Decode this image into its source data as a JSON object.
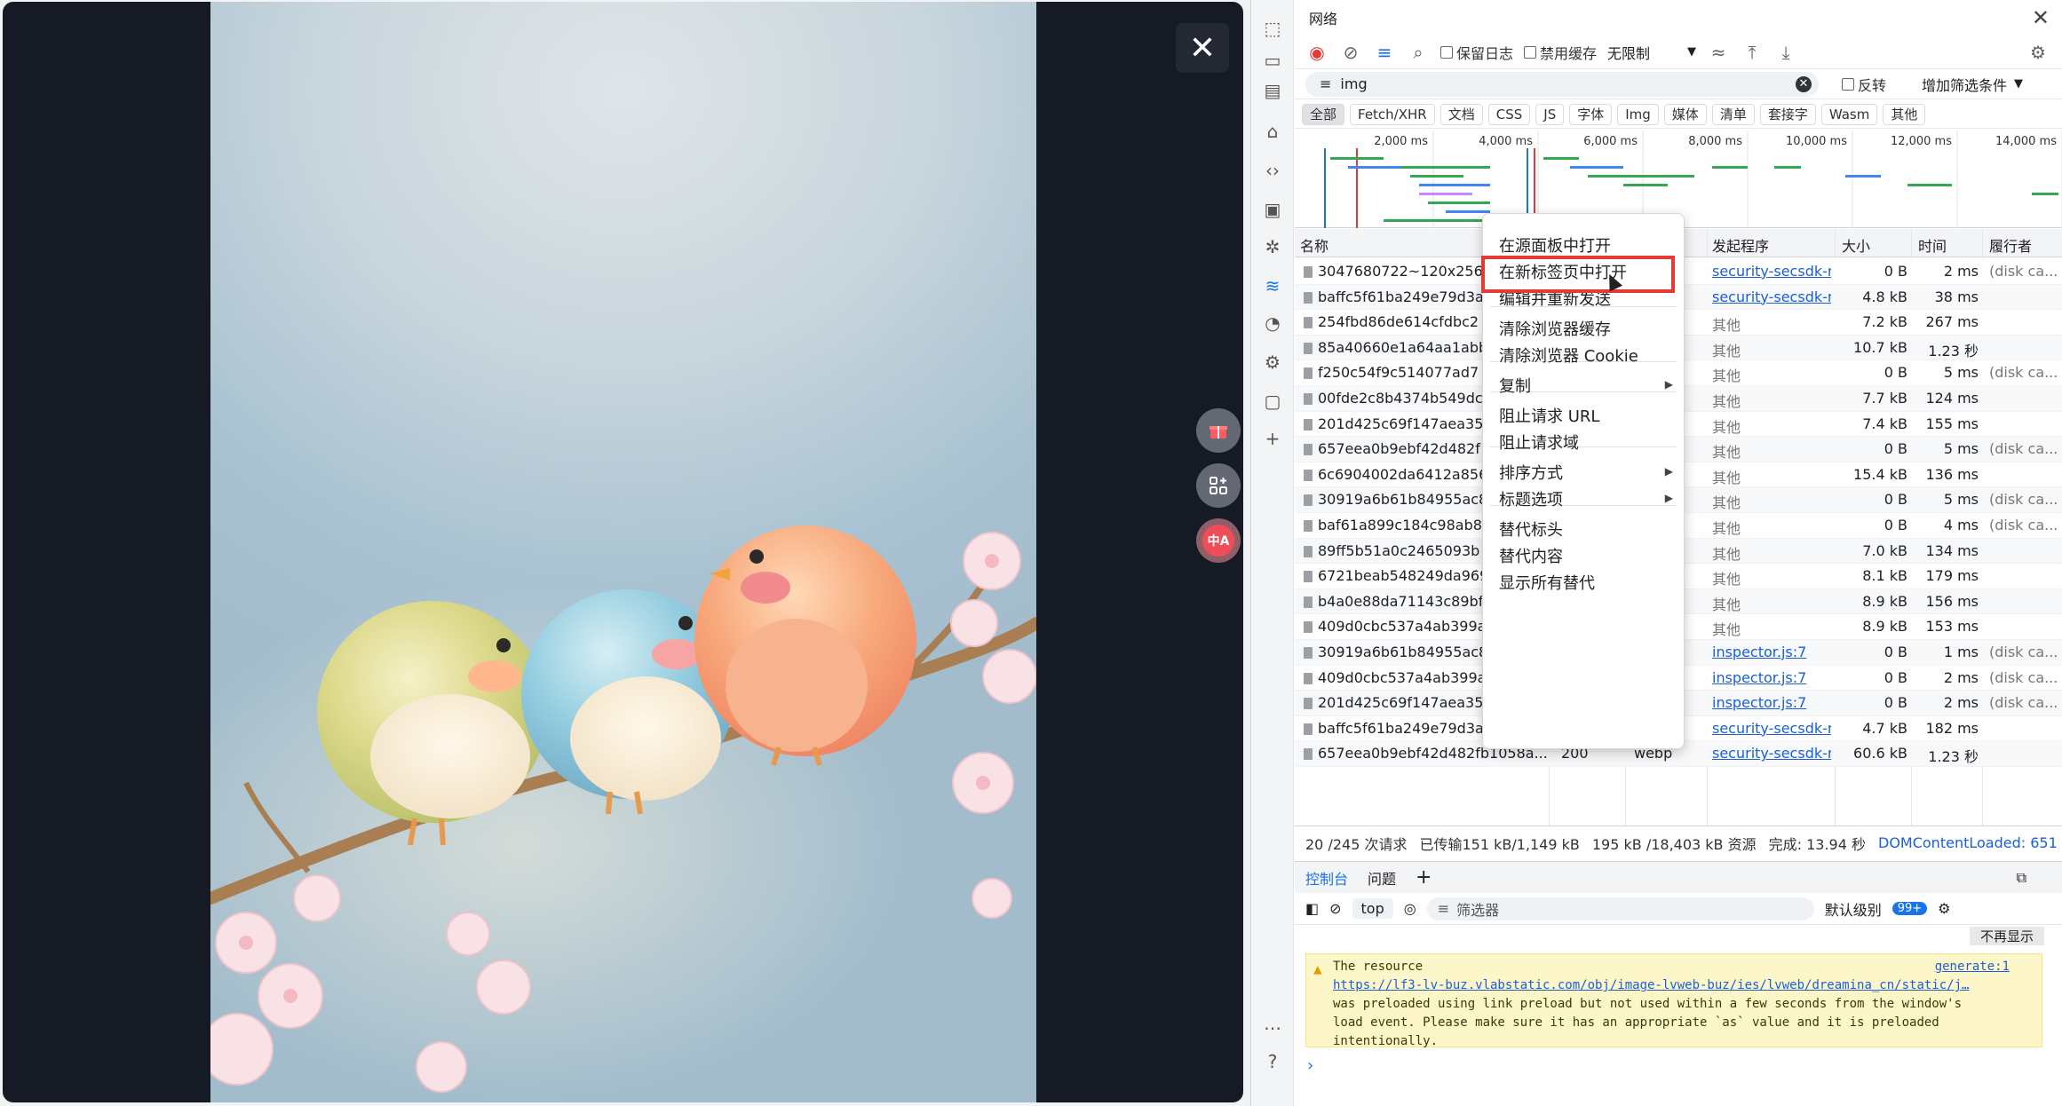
{
  "viewer": {
    "close_icon": "✕",
    "gift_icon": "gift-icon",
    "grid_icon": "grid-icon",
    "translate_label": "中A"
  },
  "devtools": {
    "panel_title": "网络",
    "toolbar": {
      "preserve_log": "保留日志",
      "disable_cache": "禁用缓存",
      "throttle": "无限制"
    },
    "filter": {
      "value": "img",
      "invert": "反转",
      "more_filters": "增加筛选条件"
    },
    "types": [
      "全部",
      "Fetch/XHR",
      "文档",
      "CSS",
      "JS",
      "字体",
      "Img",
      "媒体",
      "清单",
      "套接字",
      "Wasm",
      "其他"
    ],
    "timeline_ticks": [
      "2,000 ms",
      "4,000 ms",
      "6,000 ms",
      "8,000 ms",
      "10,000 ms",
      "12,000 ms",
      "14,000 ms"
    ],
    "columns": {
      "name": "名称",
      "initiator": "发起程序",
      "size": "大小",
      "time": "时间",
      "fulfilled": "履行者"
    },
    "rows": [
      {
        "name": "3047680722~120x256.i",
        "status": "",
        "type": "",
        "initiator": "security-secsdk-ru",
        "size": "0 B",
        "time": "2 ms",
        "fulfilled": "(disk ca..."
      },
      {
        "name": "baffc5f61ba249e79d3a",
        "status": "",
        "type": "",
        "initiator": "security-secsdk-ru",
        "size": "4.8 kB",
        "time": "38 ms",
        "fulfilled": ""
      },
      {
        "name": "254fbd86de614cfdbc2",
        "status": "",
        "type": "",
        "initiator": "其他",
        "size": "7.2 kB",
        "time": "267 ms",
        "fulfilled": ""
      },
      {
        "name": "85a40660e1a64aa1abb",
        "status": "",
        "type": "",
        "initiator": "其他",
        "size": "10.7 kB",
        "time": "1.23 秒",
        "fulfilled": ""
      },
      {
        "name": "f250c54f9c514077ad7",
        "status": "",
        "type": "",
        "initiator": "其他",
        "size": "0 B",
        "time": "5 ms",
        "fulfilled": "(disk ca..."
      },
      {
        "name": "00fde2c8b4374b549dc",
        "status": "",
        "type": "",
        "initiator": "其他",
        "size": "7.7 kB",
        "time": "124 ms",
        "fulfilled": ""
      },
      {
        "name": "201d425c69f147aea35",
        "status": "",
        "type": "",
        "initiator": "其他",
        "size": "7.4 kB",
        "time": "155 ms",
        "fulfilled": ""
      },
      {
        "name": "657eea0b9ebf42d482f",
        "status": "",
        "type": "",
        "initiator": "其他",
        "size": "0 B",
        "time": "5 ms",
        "fulfilled": "(disk ca..."
      },
      {
        "name": "6c6904002da6412a856",
        "status": "",
        "type": "",
        "initiator": "其他",
        "size": "15.4 kB",
        "time": "136 ms",
        "fulfilled": ""
      },
      {
        "name": "30919a6b61b84955ac8",
        "status": "",
        "type": "",
        "initiator": "其他",
        "size": "0 B",
        "time": "5 ms",
        "fulfilled": "(disk ca..."
      },
      {
        "name": "baf61a899c184c98ab8",
        "status": "",
        "type": "",
        "initiator": "其他",
        "size": "0 B",
        "time": "4 ms",
        "fulfilled": "(disk ca..."
      },
      {
        "name": "89ff5b51a0c2465093b",
        "status": "",
        "type": "",
        "initiator": "其他",
        "size": "7.0 kB",
        "time": "134 ms",
        "fulfilled": ""
      },
      {
        "name": "6721beab548249da969",
        "status": "",
        "type": "",
        "initiator": "其他",
        "size": "8.1 kB",
        "time": "179 ms",
        "fulfilled": ""
      },
      {
        "name": "b4a0e88da71143c89bf",
        "status": "",
        "type": "",
        "initiator": "其他",
        "size": "8.9 kB",
        "time": "156 ms",
        "fulfilled": ""
      },
      {
        "name": "409d0cbc537a4ab399a",
        "status": "",
        "type": "",
        "initiator": "其他",
        "size": "8.9 kB",
        "time": "153 ms",
        "fulfilled": ""
      },
      {
        "name": "30919a6b61b84955ac8",
        "status": "",
        "type": "",
        "initiator": "inspector.js:7",
        "size": "0 B",
        "time": "1 ms",
        "fulfilled": "(disk ca..."
      },
      {
        "name": "409d0cbc537a4ab399a",
        "status": "",
        "type": "",
        "initiator": "inspector.js:7",
        "size": "0 B",
        "time": "2 ms",
        "fulfilled": "(disk ca..."
      },
      {
        "name": "201d425c69f147aea35",
        "status": "",
        "type": "",
        "initiator": "inspector.js:7",
        "size": "0 B",
        "time": "2 ms",
        "fulfilled": "(disk ca..."
      },
      {
        "name": "baffc5f61ba249e79d3a",
        "status": "",
        "type": "",
        "initiator": "security-secsdk-ru",
        "size": "4.7 kB",
        "time": "182 ms",
        "fulfilled": ""
      },
      {
        "name": "657eea0b9ebf42d482fb1058a...",
        "status": "200",
        "type": "webp",
        "initiator": "security-secsdk-ru",
        "size": "60.6 kB",
        "time": "1.23 秒",
        "fulfilled": ""
      }
    ],
    "summary": {
      "requests": "20 /245 次请求",
      "transferred": "已传输151 kB/1,149 kB",
      "resources": "195 kB /18,403 kB 资源",
      "finish": "完成: 13.94 秒",
      "dcl": "DOMContentLoaded: 651"
    },
    "console": {
      "tab_console": "控制台",
      "tab_issues": "问题",
      "context": "top",
      "filter_placeholder": "筛选器",
      "level": "默认级别",
      "badge": "99+",
      "dont_show": "不再显示"
    },
    "warning": {
      "line1": "The resource",
      "url": "https://lf3-lv-buz.vlabstatic.com/obj/image-lvweb-buz/ies/lvweb/dreamina_cn/static/j…",
      "line3": "was preloaded using link preload but not used within a few seconds from the window's",
      "line4": "load event. Please make sure it has an appropriate `as` value and it is preloaded",
      "line5": "intentionally.",
      "source": "generate:1"
    }
  },
  "context_menu": {
    "items": [
      "在源面板中打开",
      "在新标签页中打开",
      "编辑并重新发送",
      "清除浏览器缓存",
      "清除浏览器 Cookie",
      "复制",
      "阻止请求 URL",
      "阻止请求域",
      "排序方式",
      "标题选项",
      "替代标头",
      "替代内容",
      "显示所有替代"
    ]
  },
  "colors": {
    "accent": "#1a73e8",
    "highlight": "#e53935",
    "warning_bg": "#fdf6c8",
    "viewer_bg": "#161a25"
  }
}
